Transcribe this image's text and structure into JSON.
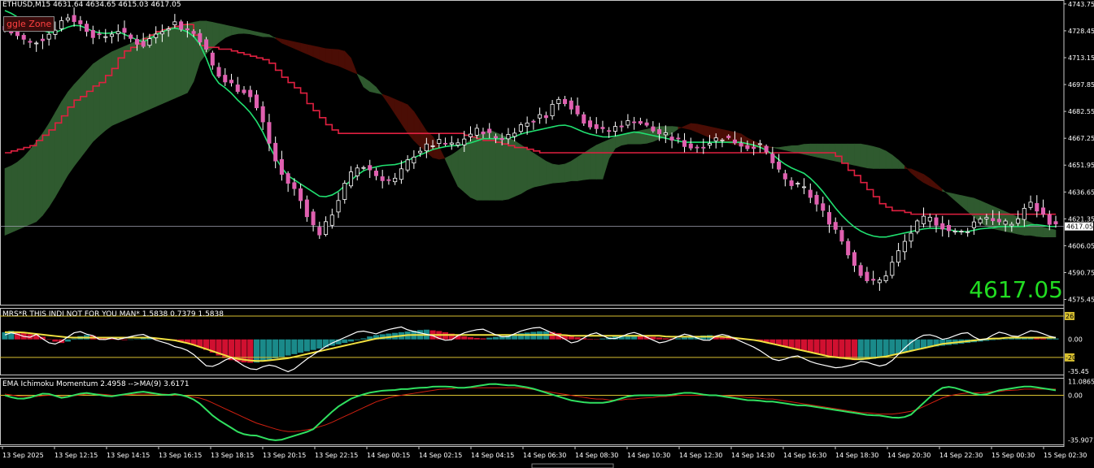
{
  "header": {
    "symbol_info": "ETHUSD,M15  4631.64 4634.65 4615.03 4617.05",
    "indicator1_label": "MRS*R THIS INDI NOT FOR YOU MAN* 1.5838 0.7379 1.5838",
    "indicator2_label": "EMA Ichimoku Momentum 2.4958 -->MA(9) 3.6171",
    "toggle_button": "ggle Zone",
    "big_price": "4617.05"
  },
  "colors": {
    "background": "#000000",
    "frame": "#c8c8c8",
    "bull_candle": "#ffffff",
    "bear_candle": "#e060b0",
    "tenkan": "#20e070",
    "kijun": "#e02040",
    "cloud_bull": "#2f5a2f",
    "cloud_bear": "#4a0d05",
    "hist_up": "#1a8a8a",
    "hist_down": "#d01030",
    "signal_yellow": "#f0e040",
    "level_line": "#d8c030"
  },
  "chart_data": [
    {
      "type": "candlestick",
      "title": "ETHUSD,M15",
      "ylim": [
        4572.0,
        4746.0
      ],
      "y_ticks": [
        "4743.75",
        "4728.45",
        "4713.15",
        "4697.85",
        "4682.55",
        "4667.25",
        "4651.95",
        "4636.65",
        "4621.35",
        "4606.05",
        "4590.75",
        "4575.45"
      ],
      "last_price_label": "4617.05",
      "last_price": 4617.05,
      "x_ticks": [
        "13 Sep 2025",
        "13 Sep 12:15",
        "13 Sep 14:15",
        "13 Sep 16:15",
        "13 Sep 18:15",
        "13 Sep 20:15",
        "13 Sep 22:15",
        "14 Sep 00:15",
        "14 Sep 02:15",
        "14 Sep 04:15",
        "14 Sep 06:30",
        "14 Sep 08:30",
        "14 Sep 10:30",
        "14 Sep 12:30",
        "14 Sep 14:30",
        "14 Sep 16:30",
        "14 Sep 18:30",
        "14 Sep 20:30",
        "14 Sep 22:30",
        "15 Sep 00:30",
        "15 Sep 02:30"
      ],
      "price_path": [
        4729,
        4727,
        4724,
        4721,
        4723,
        4725,
        4729,
        4734,
        4737,
        4733,
        4730,
        4726,
        4724,
        4727,
        4729,
        4725,
        4723,
        4720,
        4724,
        4728,
        4731,
        4733,
        4730,
        4728,
        4725,
        4716,
        4705,
        4700,
        4698,
        4695,
        4694,
        4686,
        4675,
        4660,
        4648,
        4642,
        4637,
        4628,
        4618,
        4613,
        4620,
        4630,
        4640,
        4648,
        4652,
        4650,
        4646,
        4644,
        4642,
        4648,
        4655,
        4660,
        4662,
        4664,
        4665,
        4663,
        4664,
        4668,
        4671,
        4672,
        4669,
        4667,
        4668,
        4672,
        4675,
        4677,
        4679,
        4681,
        4688,
        4690,
        4686,
        4680,
        4676,
        4674,
        4671,
        4672,
        4675,
        4676,
        4678,
        4675,
        4672,
        4670,
        4668,
        4666,
        4664,
        4662,
        4663,
        4665,
        4667,
        4668,
        4666,
        4664,
        4662,
        4664,
        4660,
        4653,
        4646,
        4641,
        4640,
        4638,
        4632,
        4626,
        4620,
        4614,
        4605,
        4596,
        4590,
        4585,
        4585,
        4590,
        4598,
        4606,
        4613,
        4619,
        4622,
        4620,
        4617,
        4614,
        4613,
        4615,
        4620,
        4623,
        4622,
        4619,
        4618,
        4619,
        4627,
        4630,
        4625,
        4621,
        4617
      ],
      "tenkan_path": [
        4740,
        4738,
        4735,
        4732,
        4730,
        4728,
        4727,
        4729,
        4731,
        4732,
        4730,
        4728,
        4727,
        4727,
        4728,
        4726,
        4724,
        4722,
        4724,
        4727,
        4729,
        4730,
        4729,
        4727,
        4722,
        4712,
        4700,
        4697,
        4693,
        4688,
        4684,
        4678,
        4670,
        4660,
        4652,
        4646,
        4643,
        4640,
        4637,
        4634,
        4634,
        4636,
        4640,
        4644,
        4648,
        4650,
        4651,
        4652,
        4652,
        4653,
        4655,
        4657,
        4659,
        4661,
        4662,
        4663,
        4663,
        4664,
        4665,
        4667,
        4667,
        4667,
        4667,
        4668,
        4670,
        4671,
        4672,
        4673,
        4674,
        4675,
        4674,
        4672,
        4670,
        4669,
        4668,
        4668,
        4669,
        4670,
        4671,
        4670,
        4669,
        4668,
        4667,
        4666,
        4665,
        4665,
        4665,
        4665,
        4665,
        4665,
        4665,
        4665,
        4664,
        4663,
        4661,
        4658,
        4654,
        4651,
        4649,
        4647,
        4643,
        4638,
        4632,
        4626,
        4621,
        4617,
        4614,
        4612,
        4611,
        4611,
        4612,
        4613,
        4614,
        4615,
        4616,
        4616,
        4616,
        4615,
        4614,
        4614,
        4615,
        4616,
        4616,
        4617,
        4617,
        4617,
        4617,
        4618,
        4618,
        4617,
        4617
      ],
      "kijun_path": [
        4659,
        4660,
        4661,
        4663,
        4666,
        4670,
        4675,
        4680,
        4686,
        4690,
        4693,
        4697,
        4700,
        4705,
        4712,
        4717,
        4720,
        4723,
        4726,
        4728,
        4730,
        4731,
        4732,
        4732,
        4720,
        4719,
        4719,
        4718,
        4717,
        4716,
        4715,
        4714,
        4712,
        4710,
        4705,
        4700,
        4696,
        4692,
        4685,
        4680,
        4675,
        4671,
        4670,
        4670,
        4670,
        4670,
        4670,
        4670,
        4670,
        4670,
        4670,
        4670,
        4670,
        4670,
        4670,
        4670,
        4670,
        4669,
        4668,
        4667,
        4666,
        4665,
        4664,
        4663,
        4662,
        4661,
        4660,
        4659,
        4659,
        4659,
        4659,
        4659,
        4659,
        4659,
        4659,
        4659,
        4659,
        4659,
        4659,
        4659,
        4659,
        4659,
        4659,
        4659,
        4659,
        4659,
        4659,
        4659,
        4659,
        4659,
        4659,
        4659,
        4659,
        4659,
        4659,
        4659,
        4659,
        4659,
        4659,
        4659,
        4659,
        4659,
        4659,
        4659,
        4655,
        4650,
        4645,
        4640,
        4635,
        4630,
        4627,
        4626,
        4625,
        4624,
        4624,
        4624,
        4624,
        4624,
        4624,
        4624,
        4624,
        4624,
        4624,
        4624,
        4624,
        4624,
        4624,
        4624,
        4624,
        4624,
        4624,
        4624
      ],
      "cloud_a_path": [
        4650,
        4652,
        4655,
        4660,
        4666,
        4672,
        4680,
        4688,
        4695,
        4700,
        4705,
        4710,
        4713,
        4716,
        4718,
        4720,
        4722,
        4724,
        4726,
        4728,
        4730,
        4731,
        4732,
        4733,
        4734,
        4734,
        4733,
        4732,
        4731,
        4730,
        4729,
        4728,
        4727,
        4726,
        4722,
        4720,
        4718,
        4716,
        4714,
        4712,
        4710,
        4709,
        4707,
        4705,
        4703,
        4700,
        4696,
        4690,
        4683,
        4676,
        4669,
        4664,
        4660,
        4656,
        4655,
        4657,
        4660,
        4664,
        4668,
        4670,
        4672,
        4670,
        4668,
        4666,
        4663,
        4660,
        4657,
        4654,
        4652,
        4652,
        4654,
        4657,
        4660,
        4663,
        4665,
        4667,
        4669,
        4670,
        4671,
        4672,
        4673,
        4674,
        4674,
        4674,
        4673,
        4672,
        4670,
        4668,
        4666,
        4665,
        4664,
        4663,
        4662,
        4662,
        4662,
        4662,
        4662,
        4663,
        4663,
        4664,
        4664,
        4664,
        4664,
        4664,
        4664,
        4664,
        4664,
        4663,
        4662,
        4660,
        4657,
        4653,
        4648,
        4644,
        4641,
        4639,
        4637,
        4636,
        4635,
        4634,
        4633,
        4631,
        4629,
        4627,
        4625,
        4623,
        4621,
        4619,
        4617,
        4616,
        4615
      ],
      "cloud_b_path": [
        4612,
        4614,
        4616,
        4618,
        4620,
        4625,
        4632,
        4640,
        4648,
        4654,
        4660,
        4666,
        4670,
        4674,
        4676,
        4678,
        4680,
        4682,
        4684,
        4686,
        4688,
        4690,
        4692,
        4694,
        4710,
        4716,
        4720,
        4724,
        4726,
        4727,
        4727,
        4726,
        4725,
        4725,
        4724,
        4723,
        4722,
        4721,
        4720,
        4719,
        4718,
        4718,
        4717,
        4712,
        4698,
        4694,
        4693,
        4692,
        4690,
        4688,
        4686,
        4680,
        4672,
        4668,
        4660,
        4650,
        4640,
        4636,
        4632,
        4632,
        4632,
        4632,
        4632,
        4634,
        4636,
        4639,
        4640,
        4641,
        4642,
        4642,
        4643,
        4643,
        4644,
        4644,
        4644,
        4660,
        4663,
        4664,
        4664,
        4664,
        4665,
        4667,
        4668,
        4672,
        4674,
        4676,
        4675,
        4674,
        4673,
        4672,
        4671,
        4670,
        4667,
        4665,
        4663,
        4662,
        4661,
        4660,
        4659,
        4658,
        4657,
        4656,
        4655,
        4654,
        4653,
        4652,
        4651,
        4650,
        4650,
        4650,
        4650,
        4650,
        4650,
        4648,
        4646,
        4642,
        4638,
        4634,
        4630,
        4626,
        4622,
        4618,
        4616,
        4615,
        4614,
        4613,
        4612,
        4612,
        4611,
        4611,
        4611
      ]
    },
    {
      "type": "histogram",
      "title": "MRS*R THIS INDI NOT FOR YOU MAN*",
      "ylim": [
        -40,
        35
      ],
      "y_ticks": [
        "26",
        "0.00",
        "-20",
        "-35.45"
      ],
      "levels": [
        26,
        -20
      ],
      "hist_path": [
        8,
        10,
        8,
        6,
        5,
        2,
        -2,
        -4,
        -2,
        3,
        5,
        4,
        2,
        1,
        0,
        -1,
        0,
        1,
        2,
        1,
        0,
        -1,
        -3,
        -5,
        -8,
        -12,
        -16,
        -20,
        -23,
        -25,
        -26,
        -26,
        -24,
        -22,
        -20,
        -18,
        -16,
        -14,
        -12,
        -10,
        -8,
        -6,
        -4,
        -2,
        0,
        3,
        5,
        6,
        7,
        8,
        9,
        10,
        11,
        10,
        9,
        7,
        5,
        3,
        2,
        1,
        2,
        3,
        4,
        6,
        7,
        8,
        9,
        9,
        8,
        6,
        4,
        2,
        1,
        0,
        1,
        3,
        4,
        5,
        5,
        4,
        3,
        2,
        1,
        1,
        2,
        3,
        4,
        5,
        4,
        3,
        2,
        1,
        0,
        -1,
        -3,
        -5,
        -7,
        -9,
        -11,
        -13,
        -15,
        -17,
        -19,
        -21,
        -22,
        -23,
        -23,
        -22,
        -21,
        -19,
        -17,
        -15,
        -13,
        -11,
        -9,
        -8,
        -7,
        -6,
        -5,
        -4,
        -3,
        -2,
        -1,
        0,
        1,
        2,
        2,
        2,
        1,
        1,
        1
      ],
      "white_path": [
        5,
        8,
        4,
        2,
        6,
        -2,
        -6,
        -2,
        4,
        10,
        6,
        4,
        -2,
        2,
        0,
        2,
        4,
        6,
        2,
        -2,
        -4,
        -8,
        -10,
        -14,
        -22,
        -30,
        -30,
        -24,
        -20,
        -26,
        -32,
        -34,
        -30,
        -28,
        -32,
        -36,
        -32,
        -24,
        -18,
        -12,
        -6,
        -2,
        2,
        6,
        10,
        8,
        6,
        10,
        12,
        14,
        10,
        8,
        6,
        4,
        0,
        -2,
        4,
        8,
        10,
        12,
        8,
        4,
        2,
        6,
        10,
        12,
        14,
        10,
        6,
        2,
        -4,
        -2,
        4,
        8,
        4,
        0,
        2,
        6,
        8,
        4,
        0,
        -4,
        -2,
        2,
        6,
        4,
        0,
        -2,
        4,
        6,
        2,
        -2,
        -6,
        -10,
        -16,
        -22,
        -24,
        -20,
        -18,
        -22,
        -26,
        -28,
        -30,
        -32,
        -30,
        -28,
        -24,
        -26,
        -30,
        -28,
        -22,
        -12,
        -4,
        2,
        6,
        4,
        0,
        2,
        6,
        8,
        2,
        -2,
        4,
        8,
        6,
        2,
        6,
        10,
        8,
        4,
        2
      ],
      "yellow_path": [
        8,
        8,
        8,
        7,
        6,
        5,
        4,
        3,
        2,
        2,
        2,
        2,
        2,
        2,
        2,
        2,
        2,
        2,
        2,
        1,
        0,
        -1,
        -3,
        -5,
        -8,
        -11,
        -14,
        -17,
        -20,
        -22,
        -23,
        -24,
        -24,
        -23,
        -22,
        -21,
        -19,
        -17,
        -15,
        -13,
        -11,
        -9,
        -7,
        -5,
        -3,
        -1,
        1,
        2,
        3,
        4,
        5,
        5,
        5,
        5,
        5,
        5,
        5,
        5,
        5,
        5,
        5,
        5,
        5,
        5,
        5,
        5,
        5,
        5,
        5,
        5,
        4,
        4,
        4,
        4,
        4,
        4,
        4,
        4,
        4,
        4,
        4,
        4,
        3,
        3,
        3,
        3,
        3,
        3,
        3,
        3,
        2,
        1,
        0,
        -1,
        -3,
        -5,
        -7,
        -9,
        -11,
        -13,
        -15,
        -17,
        -19,
        -20,
        -21,
        -22,
        -22,
        -21,
        -20,
        -19,
        -17,
        -15,
        -13,
        -11,
        -9,
        -7,
        -5,
        -4,
        -3,
        -2,
        -1,
        0,
        1,
        1,
        2,
        2,
        2,
        2,
        2,
        2,
        2
      ]
    },
    {
      "type": "line",
      "title": "EMA Ichimoku Momentum",
      "ylim": [
        -40,
        14
      ],
      "y_ticks": [
        "11.0865",
        "0.00",
        "-35.9071"
      ],
      "level": 0,
      "green_path": [
        0,
        -2,
        -3,
        -2,
        0,
        2,
        0,
        -2,
        -1,
        1,
        2,
        1,
        0,
        -1,
        0,
        1,
        2,
        3,
        2,
        1,
        0,
        1,
        0,
        -2,
        -6,
        -12,
        -18,
        -22,
        -26,
        -30,
        -32,
        -32,
        -34,
        -36,
        -36,
        -34,
        -32,
        -30,
        -28,
        -22,
        -16,
        -10,
        -6,
        -2,
        0,
        2,
        3,
        4,
        4,
        5,
        5,
        6,
        6,
        7,
        7,
        7,
        6,
        6,
        7,
        8,
        9,
        9,
        8,
        8,
        7,
        6,
        4,
        2,
        0,
        -2,
        -4,
        -5,
        -6,
        -6,
        -6,
        -5,
        -3,
        -1,
        0,
        0,
        0,
        0,
        0,
        1,
        2,
        2,
        1,
        0,
        0,
        -1,
        -2,
        -3,
        -4,
        -4,
        -5,
        -5,
        -6,
        -7,
        -8,
        -8,
        -9,
        -10,
        -11,
        -12,
        -13,
        -14,
        -15,
        -16,
        -16,
        -17,
        -18,
        -18,
        -16,
        -10,
        -4,
        2,
        6,
        7,
        5,
        3,
        1,
        0,
        2,
        4,
        5,
        6,
        7,
        7,
        6,
        5,
        4
      ],
      "red_path": [
        1,
        0,
        -1,
        -1,
        -1,
        0,
        0,
        -1,
        -1,
        0,
        1,
        1,
        1,
        0,
        0,
        0,
        1,
        1,
        1,
        1,
        1,
        0,
        0,
        -1,
        -2,
        -4,
        -7,
        -10,
        -13,
        -16,
        -19,
        -22,
        -24,
        -26,
        -28,
        -29,
        -29,
        -28,
        -27,
        -25,
        -23,
        -20,
        -17,
        -14,
        -11,
        -8,
        -5,
        -3,
        -1,
        0,
        1,
        2,
        3,
        4,
        5,
        5,
        6,
        6,
        6,
        6,
        6,
        6,
        6,
        6,
        6,
        5,
        4,
        3,
        2,
        1,
        0,
        -1,
        -2,
        -3,
        -3,
        -4,
        -4,
        -3,
        -3,
        -2,
        -2,
        -1,
        -1,
        0,
        0,
        0,
        0,
        0,
        0,
        0,
        -1,
        -1,
        -2,
        -2,
        -3,
        -3,
        -4,
        -5,
        -6,
        -7,
        -8,
        -9,
        -10,
        -11,
        -12,
        -13,
        -14,
        -14,
        -15,
        -15,
        -15,
        -14,
        -13,
        -11,
        -8,
        -5,
        -2,
        0,
        1,
        2,
        2,
        2,
        3,
        3,
        4,
        4,
        5,
        5,
        5,
        5,
        5
      ]
    }
  ]
}
